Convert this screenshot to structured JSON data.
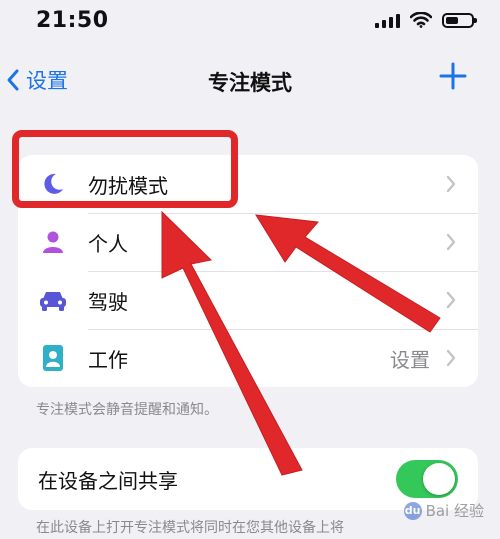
{
  "status_bar": {
    "time": "21:50"
  },
  "nav": {
    "back_label": "设置",
    "title": "专注模式",
    "add_symbol": "+"
  },
  "focus_modes": [
    {
      "label": "勿扰模式",
      "icon": "moon-icon",
      "value": ""
    },
    {
      "label": "个人",
      "icon": "person-icon",
      "value": ""
    },
    {
      "label": "驾驶",
      "icon": "car-icon",
      "value": ""
    },
    {
      "label": "工作",
      "icon": "id-badge-icon",
      "value": "设置"
    }
  ],
  "focus_footnote": "专注模式会静音提醒和通知。",
  "share": {
    "label": "在设备之间共享",
    "enabled": true,
    "footnote": "在此设备上打开专注模式将同时在您其他设备上将"
  },
  "watermark": {
    "text": "Bai 经验"
  },
  "colors": {
    "accent": "#1a74e8",
    "annotation_red": "#e0282b",
    "toggle_on": "#34c759",
    "moon": "#5e5ce6",
    "person": "#af52de",
    "car": "#5856d6",
    "work": "#30b0c7"
  }
}
